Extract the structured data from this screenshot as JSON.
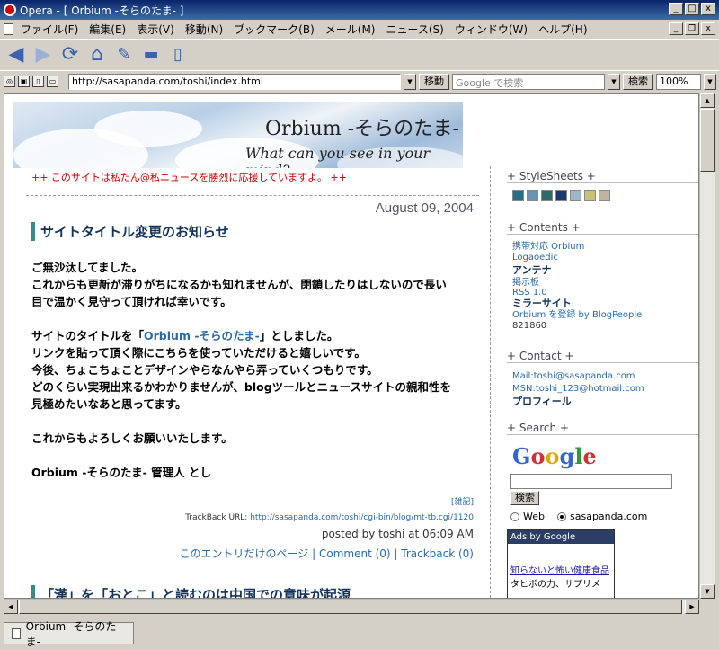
{
  "window": {
    "title": "Opera - [ Orbium -そらのたま- ]",
    "controls": [
      "_",
      "□",
      "x"
    ]
  },
  "menu": {
    "items": [
      "ファイル(F)",
      "編集(E)",
      "表示(V)",
      "移動(N)",
      "ブックマーク(B)",
      "メール(M)",
      "ニュース(S)",
      "ウィンドウ(W)",
      "ヘルプ(H)"
    ]
  },
  "address": {
    "url": "http://sasapanda.com/toshi/index.html",
    "go_label": "移動",
    "search_placeholder": "Google で検索",
    "search_label": "検索",
    "zoom": "100%"
  },
  "page": {
    "banner_title": "Orbium -そらのたま-",
    "banner_subtitle": "What can you see in your mind?",
    "promo": "++ このサイトは私たん@私ニュースを勝烈に応援していますよ。 ++",
    "date": "August 09, 2004",
    "entry_title": "サイトタイトル変更のお知らせ",
    "para1_l1": "ご無沙汰してました。",
    "para1_l2": "これからも更新が滞りがちになるかも知れませんが、閉鎖したりはしないので長い",
    "para1_l3": "目で温かく見守って頂ければ幸いです。",
    "para2_pre": "サイトのタイトルを「",
    "para2_link": "Orbium -そらのたま-",
    "para2_post": "」としました。",
    "para2_l2": "リンクを貼って頂く際にこちらを使っていただけると嬉しいです。",
    "para2_l3": "今後、ちょこちょことデザインやらなんやら弄っていくつもりです。",
    "para2_l4": "どのくらい実現出来るかわかりませんが、blogツールとニュースサイトの親和性を",
    "para2_l5": "見極めたいなあと思ってます。",
    "para3": "これからもよろしくお願いいたします。",
    "signature": "Orbium -そらのたま- 管理人 とし",
    "tags": "[雑記]",
    "trackback_label": "TrackBack URL: ",
    "trackback_url": "http://sasapanda.com/toshi/cgi-bin/blog/mt-tb.cgi/1120",
    "posted": "posted by toshi at 06:09 AM",
    "links": "このエントリだけのページ | Comment (0) | Trackback (0)",
    "entry2_title": "「漢」を「おとこ」と読むのは中国での意味が起源"
  },
  "sidebar": {
    "stylesheets": "+ StyleSheets +",
    "swatch_colors": [
      "#2a6d8a",
      "#6d93b3",
      "#2f6a6a",
      "#1b3a6b",
      "#9fb6c9",
      "#c9c07a",
      "#bfb3a0"
    ],
    "contents": "+ Contents +",
    "c1": "携帯対応 Orbium",
    "c2": "Logaoedic",
    "c3": "アンテナ",
    "c4": "掲示板",
    "c5": "RSS 1.0",
    "c6": "ミラーサイト",
    "c7": "Orbium を登録 by BlogPeople",
    "c8": "821860",
    "contact": "+ Contact +",
    "mail": "Mail:toshi@sasapanda.com",
    "msn": "MSN:toshi_123@hotmail.com",
    "profile": "プロフィール",
    "search": "+ Search +",
    "google": "Google",
    "search_btn": "検索",
    "radio_web": "Web",
    "radio_site": "sasapanda.com",
    "ads_header": "Ads by Google",
    "ad_link": "知らないと怖い健康食品",
    "ad_text": "タヒボの力、サプリメ"
  },
  "status": {
    "tab": "Orbium -そらのたま-"
  }
}
